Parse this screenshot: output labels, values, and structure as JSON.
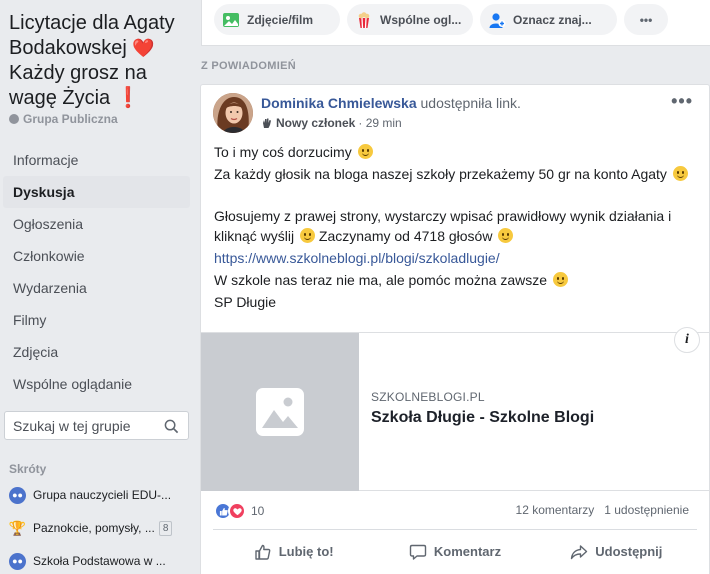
{
  "group": {
    "title_line1": "Licytacje dla Agaty",
    "title_line2": "Bodakowskej",
    "title_heart": "❤️",
    "title_line3": "Każdy grosz na",
    "title_line4": "wagę Życia",
    "title_bang": "❗",
    "type": "Grupa Publiczna"
  },
  "nav": [
    {
      "label": "Informacje"
    },
    {
      "label": "Dyskusja",
      "active": true
    },
    {
      "label": "Ogłoszenia"
    },
    {
      "label": "Członkowie"
    },
    {
      "label": "Wydarzenia"
    },
    {
      "label": "Filmy"
    },
    {
      "label": "Zdjęcia"
    },
    {
      "label": "Wspólne oglądanie"
    }
  ],
  "search": {
    "placeholder": "Szukaj w tej grupie"
  },
  "shortcuts": {
    "title": "Skróty",
    "items": [
      {
        "label": "Grupa nauczycieli EDU-...",
        "icon": "group-icon"
      },
      {
        "label": "Paznokcie, pomysły, ...",
        "icon": "trophy-icon",
        "badge": "8"
      },
      {
        "label": "Szkoła Podstawowa w ...",
        "icon": "group-icon"
      }
    ]
  },
  "composer": {
    "photo_label": "Zdjęcie/film",
    "watch_label": "Wspólne ogl...",
    "tag_label": "Oznacz znaj...",
    "more_label": "•••"
  },
  "section_label": "Z POWIADOMIEŃ",
  "post": {
    "author": "Dominika Chmielewska",
    "action": " udostępniła link.",
    "badge": "Nowy członek",
    "time": " · 29 min",
    "lines": {
      "l1": "To i my coś dorzucimy",
      "l2": "Za każdy głosik na bloga naszej szkoły przekażemy 50 gr na konto Agaty",
      "l3": "Głosujemy z prawej strony, wystarczy wpisać prawidłowy wynik działania i",
      "l4a": "kliknąć wyślij",
      "l4b": " Zaczynamy od 4718 głosów",
      "l5": "https://www.szkolneblogi.pl/blogi/szkoladlugie/",
      "l6": "W szkole nas teraz nie ma, ale pomóc można zawsze",
      "l7": "SP Długie"
    },
    "link": {
      "domain": "SZKOLNEBLOGI.PL",
      "title": "Szkoła Długie - Szkolne Blogi",
      "info": "i"
    },
    "reaction_count": "10",
    "comments": "12 komentarzy",
    "shares": "1 udostępnienie",
    "actions": {
      "like": "Lubię to!",
      "comment": "Komentarz",
      "share": "Udostępnij"
    }
  },
  "colors": {
    "link": "#385898",
    "love": "#f0405f",
    "like": "#4a77d6"
  }
}
